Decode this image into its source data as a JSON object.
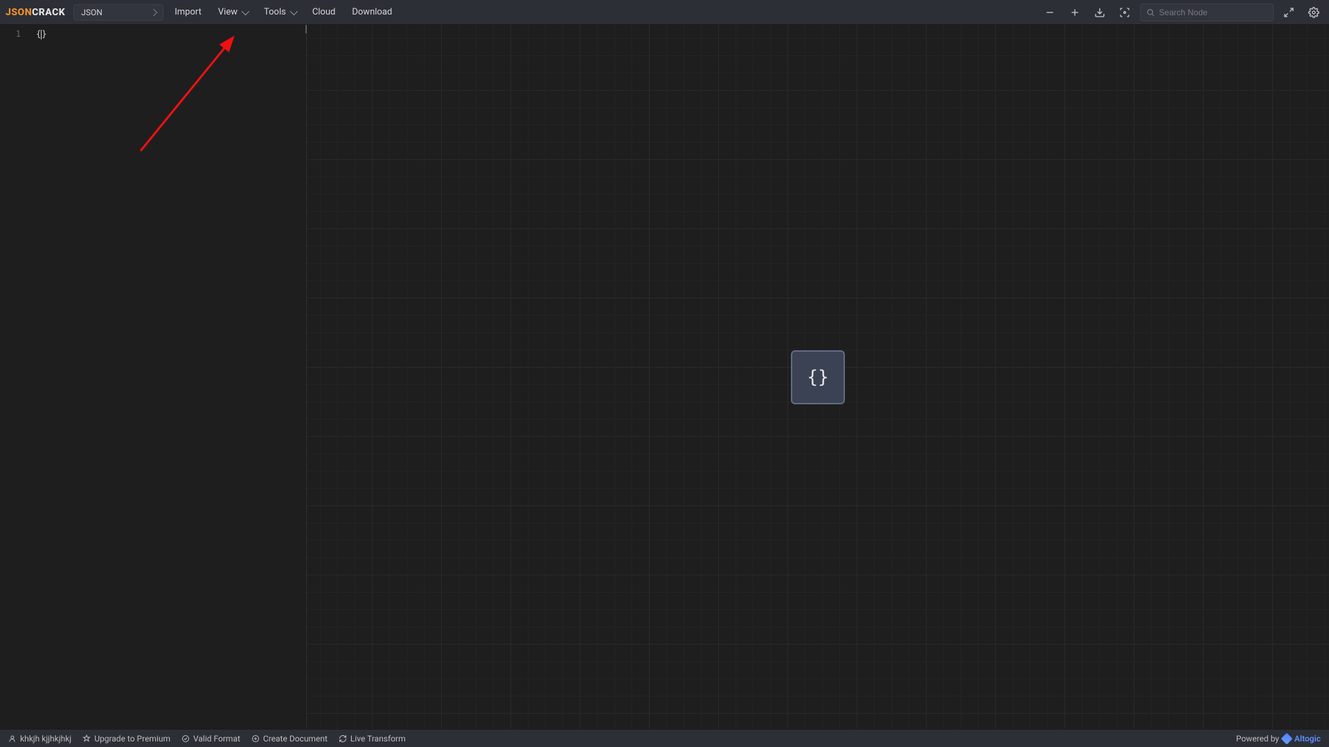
{
  "logo": {
    "part1": "JSON",
    "part2": "CRACK"
  },
  "format_selector": {
    "value": "JSON"
  },
  "menu": {
    "import": "Import",
    "view": "View",
    "tools": "Tools",
    "cloud": "Cloud",
    "download": "Download"
  },
  "search": {
    "placeholder": "Search Node"
  },
  "editor": {
    "line_number": "1",
    "content_left": "{",
    "content_right": "}"
  },
  "canvas": {
    "root_node_label": "{}"
  },
  "bottombar": {
    "user": "khkjh kjjhkjhkj",
    "upgrade": "Upgrade to Premium",
    "valid": "Valid Format",
    "create_doc": "Create Document",
    "live": "Live Transform",
    "powered_by": "Powered by",
    "powered_brand": "Altogic"
  }
}
